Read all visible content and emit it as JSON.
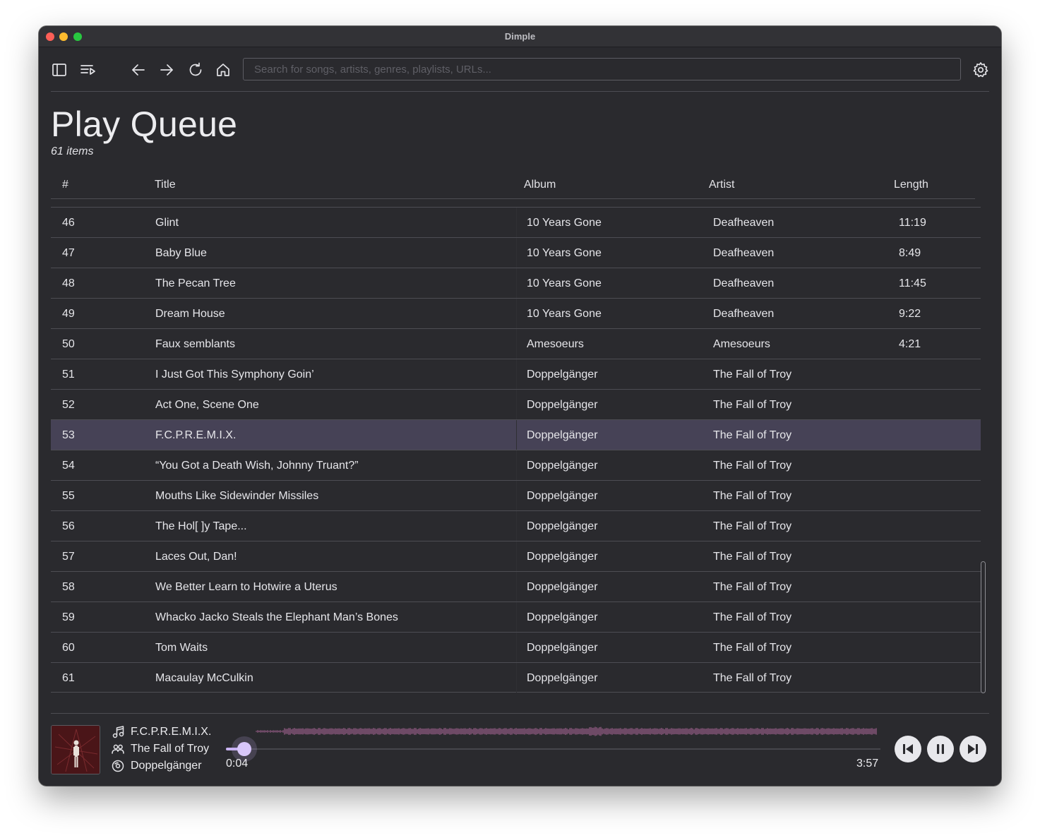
{
  "window": {
    "title": "Dimple"
  },
  "toolbar": {
    "search_placeholder": "Search for songs, artists, genres, playlists, URLs..."
  },
  "page": {
    "title": "Play Queue",
    "item_count": "61 items"
  },
  "table": {
    "headers": {
      "num": "#",
      "title": "Title",
      "album": "Album",
      "artist": "Artist",
      "length": "Length"
    },
    "selected_index": 7,
    "rows": [
      {
        "num": "46",
        "title": "Glint",
        "album": "10 Years Gone",
        "artist": "Deafheaven",
        "length": "11:19"
      },
      {
        "num": "47",
        "title": "Baby Blue",
        "album": "10 Years Gone",
        "artist": "Deafheaven",
        "length": "8:49"
      },
      {
        "num": "48",
        "title": "The Pecan Tree",
        "album": "10 Years Gone",
        "artist": "Deafheaven",
        "length": "11:45"
      },
      {
        "num": "49",
        "title": "Dream House",
        "album": "10 Years Gone",
        "artist": "Deafheaven",
        "length": "9:22"
      },
      {
        "num": "50",
        "title": "Faux semblants",
        "album": "Amesoeurs",
        "artist": "Amesoeurs",
        "length": "4:21"
      },
      {
        "num": "51",
        "title": "I Just Got This Symphony Goin’",
        "album": "Doppelgänger",
        "artist": "The Fall of Troy",
        "length": ""
      },
      {
        "num": "52",
        "title": "Act One, Scene One",
        "album": "Doppelgänger",
        "artist": "The Fall of Troy",
        "length": ""
      },
      {
        "num": "53",
        "title": "F.C.P.R.E.M.I.X.",
        "album": "Doppelgänger",
        "artist": "The Fall of Troy",
        "length": ""
      },
      {
        "num": "54",
        "title": "“You Got a Death Wish, Johnny Truant?”",
        "album": "Doppelgänger",
        "artist": "The Fall of Troy",
        "length": ""
      },
      {
        "num": "55",
        "title": "Mouths Like Sidewinder Missiles",
        "album": "Doppelgänger",
        "artist": "The Fall of Troy",
        "length": ""
      },
      {
        "num": "56",
        "title": "The Hol[ ]y Tape...",
        "album": "Doppelgänger",
        "artist": "The Fall of Troy",
        "length": ""
      },
      {
        "num": "57",
        "title": "Laces Out, Dan!",
        "album": "Doppelgänger",
        "artist": "The Fall of Troy",
        "length": ""
      },
      {
        "num": "58",
        "title": "We Better Learn to Hotwire a Uterus",
        "album": "Doppelgänger",
        "artist": "The Fall of Troy",
        "length": ""
      },
      {
        "num": "59",
        "title": "Whacko Jacko Steals the Elephant Man’s Bones",
        "album": "Doppelgänger",
        "artist": "The Fall of Troy",
        "length": ""
      },
      {
        "num": "60",
        "title": "Tom Waits",
        "album": "Doppelgänger",
        "artist": "The Fall of Troy",
        "length": ""
      },
      {
        "num": "61",
        "title": "Macaulay McCulkin",
        "album": "Doppelgänger",
        "artist": "The Fall of Troy",
        "length": ""
      }
    ]
  },
  "player": {
    "track": "F.C.P.R.E.M.I.X.",
    "artist": "The Fall of Troy",
    "album": "Doppelgänger",
    "current_time": "0:04",
    "total_time": "3:57",
    "progress_fraction": 0.017
  },
  "icons": {
    "sidebar_toggle": "sidebar-icon",
    "queue": "queue-icon",
    "back": "arrow-left-icon",
    "forward": "arrow-right-icon",
    "reload": "reload-icon",
    "home": "home-icon",
    "settings": "gear-icon",
    "song": "music-note-icon",
    "artist": "people-icon",
    "album": "disc-icon",
    "prev": "skip-previous-icon",
    "pause": "pause-icon",
    "next": "skip-next-icon"
  },
  "colors": {
    "background": "#2a2a2e",
    "selected_row": "#464256",
    "accent": "#c9b3f3",
    "waveform": "#6e4a66"
  }
}
